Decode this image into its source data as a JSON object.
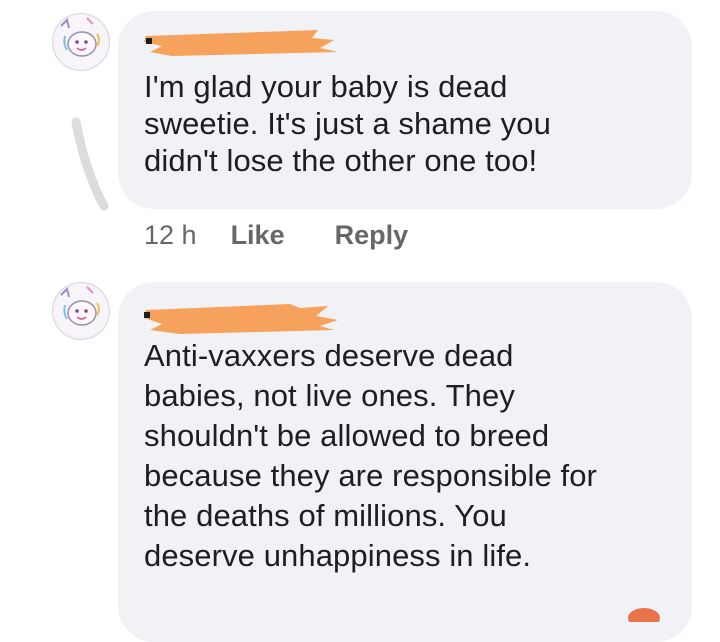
{
  "comments": [
    {
      "text": "I'm glad your baby is dead\nsweetie.  It's just a shame you\ndidn't lose the other one too!",
      "time": "12 h",
      "like_label": "Like",
      "reply_label": "Reply",
      "author_redacted": true
    },
    {
      "text": "Anti-vaxxers deserve dead\nbabies, not live ones.  They\nshouldn't be allowed to breed\nbecause they are responsible for\nthe deaths of millions.  You\ndeserve unhappiness in life.",
      "author_redacted": true
    }
  ],
  "colors": {
    "bubble": "#f0f2f5",
    "redaction": "#f6a15c",
    "meta_text": "#65676b",
    "body_text": "#1c1e21"
  },
  "icons": {
    "avatar": "cartoon-face-avatar-icon",
    "redaction": "orange-scribble-redaction"
  }
}
